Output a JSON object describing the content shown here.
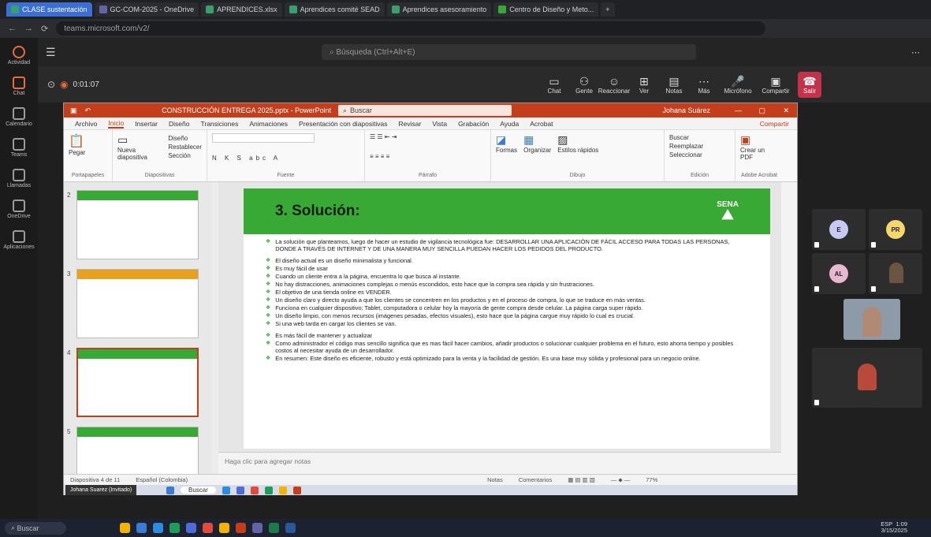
{
  "browser": {
    "tabs": [
      "GC-COM-2025 - OneDrive",
      "APRENDICES.xlsx",
      "Aprendices comité SEAD",
      "Aprendices asesoramiento",
      "Centro de Diseño y Meto..."
    ],
    "active_tab": "CLASE sustentación",
    "url": "teams.microsoft.com/v2/"
  },
  "teams": {
    "search_placeholder": "Búsqueda (Ctrl+Alt+E)",
    "meeting_title": "0:01:07",
    "rail": [
      "Actividad",
      "Chat",
      "Calendario",
      "Teams",
      "Llamadas",
      "OneDrive",
      "Aplicaciones"
    ],
    "controls": [
      "Chat",
      "Gente",
      "Reaccionar",
      "Ver",
      "Notas",
      "Más",
      "Micrófono",
      "Compartir",
      "Salir"
    ]
  },
  "ppt": {
    "title": "CONSTRUCCIÓN ENTREGA 2025.pptx - PowerPoint",
    "search": "Buscar",
    "user": "Johana Suárez",
    "menu": [
      "Archivo",
      "Inicio",
      "Insertar",
      "Diseño",
      "Transiciones",
      "Animaciones",
      "Presentación con diapositivas",
      "Revisar",
      "Vista",
      "Grabación",
      "Ayuda",
      "Acrobat"
    ],
    "active_menu": "Inicio",
    "share": "Compartir",
    "ribbon_groups": [
      "Portapapeles",
      "Diapositivas",
      "Fuente",
      "Párrafo",
      "Dibujo",
      "Edición",
      "Adobe Acrobat"
    ],
    "ribbon_buttons": [
      "Pegar",
      "Nueva diapositiva",
      "Diseño",
      "Restablecer",
      "Sección",
      "Formas",
      "Organizar",
      "Estilos rápidos",
      "Buscar",
      "Reemplazar",
      "Seleccionar",
      "Crear un PDF"
    ],
    "thumb_nums": [
      "2",
      "3",
      "4",
      "5"
    ],
    "slide": {
      "title": "3. Solución:",
      "logo": "SENA",
      "bullets": [
        "La solución que planteamos, luego de hacer un estudio de vigilancia tecnológica fue: DESARROLLAR UNA APLICACIÓN DE FÁCIL ACCESO PARA TODAS LAS PERSONAS, DONDE A TRAVÉS DE INTERNET Y DE UNA MANERA MUY SENCILLA PUEDAN HACER LOS PEDIDOS DEL PRODUCTO.",
        "",
        "El diseño actual es un diseño minimalista y funcional.",
        "Es muy fácil de usar",
        "Cuando un cliente entra a la página, encuentra lo que busca al instante.",
        "No hay distracciones, animaciones complejas o menús escondidos, esto hace que la compra sea rápida y sin frustraciones.",
        "El objetivo de una tienda online es VENDER.",
        "Un diseño claro y directo ayuda a que los clientes se concentren en los productos y en el proceso de compra, lo que se traduce en más ventas.",
        "Funciona en cualquier dispositivo; Tablet, computadora o celular hoy la mayoría de gente compra desde celular. La página carga super rápido.",
        "Un diseño limpio, con menos recursos (imágenes pesadas, efectos visuales), esto hace que la página cargue muy rápido lo cual es crucial.",
        "Si una web tarda en cargar los clientes se van.",
        "",
        "Es más fácil de mantener y actualizar",
        "Como administrador el código mas sencillo significa que es mas fácil hacer cambios, añadir productos o solucionar cualquier problema en el futuro, esto ahorra tiempo y posibles costos al necesitar ayuda de un desarrollador.",
        "En resumen: Este diseño es eficiente, robusto y está optimizado para la venta y la facilidad de gestión. Es una base muy sólida y profesional para un negocio online."
      ]
    },
    "notes_placeholder": "Haga clic para agregar notas",
    "status": [
      "Diapositiva 4 de 11",
      "Español (Colombia)",
      "Notas",
      "Comentarios",
      "77%"
    ]
  },
  "presenter_label": "Johana Suarez (Invitado)",
  "inner_taskbar_search": "Buscar",
  "gallery": [
    "E",
    "PR",
    "AL"
  ],
  "windows": {
    "search": "Buscar",
    "time": "1:09",
    "date": "3/15/2025",
    "lang": "ESP"
  }
}
